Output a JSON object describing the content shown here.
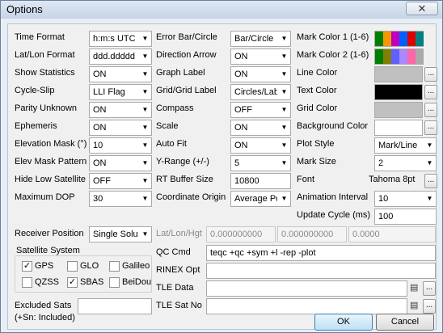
{
  "window": {
    "title": "Options",
    "close_glyph": "✕"
  },
  "rows_left": [
    {
      "label": "Time Format",
      "value": "h:m:s UTC"
    },
    {
      "label": "Lat/Lon Format",
      "value": "ddd.ddddd"
    },
    {
      "label": "Show Statistics",
      "value": "ON"
    },
    {
      "label": "Cycle-Slip",
      "value": "LLI Flag"
    },
    {
      "label": "Parity Unknown",
      "value": "ON"
    },
    {
      "label": "Ephemeris",
      "value": "ON"
    },
    {
      "label": "Elevation Mask (°)",
      "value": "10"
    },
    {
      "label": "Elev Mask Pattern",
      "value": "ON"
    },
    {
      "label": "Hide Low Satellite",
      "value": "OFF"
    },
    {
      "label": "Maximum DOP",
      "value": "30"
    }
  ],
  "rows_mid": [
    {
      "label": "Error Bar/Circle",
      "value": "Bar/Circle"
    },
    {
      "label": "Direction Arrow",
      "value": "ON"
    },
    {
      "label": "Graph Label",
      "value": "ON"
    },
    {
      "label": "Grid/Grid Label",
      "value": "Circles/Labels"
    },
    {
      "label": "Compass",
      "value": "OFF"
    },
    {
      "label": "Scale",
      "value": "ON"
    },
    {
      "label": "Auto Fit",
      "value": "ON"
    },
    {
      "label": "Y-Range (+/-)",
      "value": "5"
    },
    {
      "label": "RT Buffer Size",
      "value": "10800"
    },
    {
      "label": "Coordinate Origin",
      "value": "Average Position"
    }
  ],
  "rows_right": {
    "mark_color_1": "Mark Color 1 (1-6)",
    "mark_color_2": "Mark Color 2 (1-6)",
    "line_color": "Line Color",
    "text_color": "Text Color",
    "grid_color": "Grid Color",
    "background_color": "Background Color",
    "plot_style": {
      "label": "Plot Style",
      "value": "Mark/Line"
    },
    "mark_size": {
      "label": "Mark Size",
      "value": "2"
    },
    "font": {
      "label": "Font",
      "value": "Tahoma 8pt"
    },
    "animation_interval": {
      "label": "Animation Interval",
      "value": "10"
    },
    "update_cycle": {
      "label": "Update Cycle (ms)",
      "value": "100"
    }
  },
  "colors": {
    "mark1": [
      "#008000",
      "#f29900",
      "#c000c0",
      "#0060ff",
      "#e00000",
      "#008080"
    ],
    "mark2": [
      "#008000",
      "#808000",
      "#6060ff",
      "#aa88ff",
      "#ff66aa",
      "#aaaaaa"
    ],
    "line": "#c0c0c0",
    "text": "#000000",
    "grid": "#c0c0c0",
    "background": "#ffffff"
  },
  "receiver": {
    "label": "Receiver Position",
    "value": "Single Solution",
    "llh_label": "Lat/Lon/Hgt",
    "lat": "0.000000000",
    "lon": "0.000000000",
    "hgt": "0.0000"
  },
  "satsys": {
    "title": "Satellite System",
    "items": [
      {
        "label": "GPS",
        "checked": "✓"
      },
      {
        "label": "GLO",
        "checked": ""
      },
      {
        "label": "Galileo",
        "checked": ""
      },
      {
        "label": "QZSS",
        "checked": ""
      },
      {
        "label": "SBAS",
        "checked": "✓"
      },
      {
        "label": "BeiDou",
        "checked": ""
      }
    ]
  },
  "qc": {
    "label": "QC Cmd",
    "value": "teqc +qc +sym +l -rep -plot"
  },
  "rinex": {
    "label": "RINEX Opt",
    "value": ""
  },
  "tle_data": {
    "label": "TLE Data",
    "value": ""
  },
  "tle_sat": {
    "label": "TLE Sat No",
    "value": ""
  },
  "excluded": {
    "label": "Excluded Sats",
    "sublabel": "(+Sn: Included)",
    "value": ""
  },
  "buttons": {
    "ok": "OK",
    "cancel": "Cancel",
    "dots": "..."
  }
}
